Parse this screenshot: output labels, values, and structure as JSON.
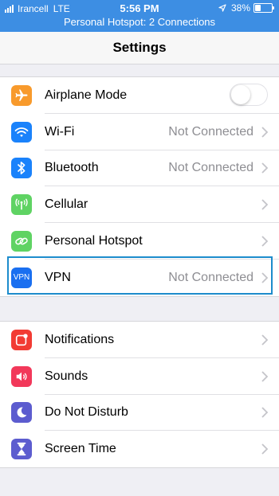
{
  "status_bar": {
    "carrier": "Irancell",
    "network": "LTE",
    "time": "5:56 PM",
    "battery": "38%",
    "battery_level": 0.38,
    "hotspot_banner": "Personal Hotspot: 2 Connections"
  },
  "nav": {
    "title": "Settings"
  },
  "group1": [
    {
      "label": "Airplane Mode",
      "icon": "airplane-icon",
      "color": "#f89a2c",
      "toggle": false
    },
    {
      "label": "Wi-Fi",
      "icon": "wifi-icon",
      "color": "#1a82fb",
      "value": "Not Connected"
    },
    {
      "label": "Bluetooth",
      "icon": "bluetooth-icon",
      "color": "#1a82fb",
      "value": "Not Connected"
    },
    {
      "label": "Cellular",
      "icon": "cellular-icon",
      "color": "#5fd363",
      "value": ""
    },
    {
      "label": "Personal Hotspot",
      "icon": "hotspot-icon",
      "color": "#5fd363",
      "value": ""
    },
    {
      "label": "VPN",
      "icon": "vpn-icon",
      "icon_text": "VPN",
      "color": "#1a6ff0",
      "value": "Not Connected"
    }
  ],
  "group2": [
    {
      "label": "Notifications",
      "icon": "notifications-icon",
      "color": "#f23b33"
    },
    {
      "label": "Sounds",
      "icon": "sounds-icon",
      "color": "#f2385a"
    },
    {
      "label": "Do Not Disturb",
      "icon": "moon-icon",
      "color": "#5c5ccf"
    },
    {
      "label": "Screen Time",
      "icon": "hourglass-icon",
      "color": "#5c5ccf"
    }
  ]
}
